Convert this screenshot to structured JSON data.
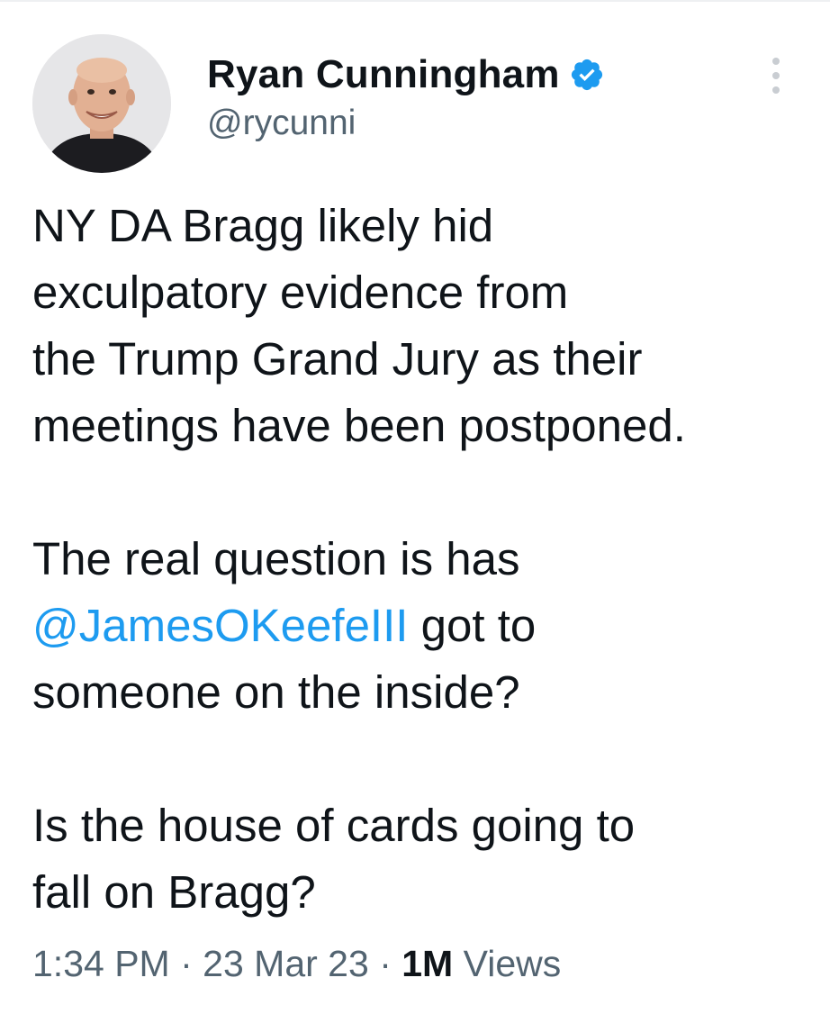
{
  "author": {
    "display_name": "Ryan Cunningham",
    "handle": "@rycunni",
    "verified": true,
    "avatar_icon": "profile-photo"
  },
  "tweet": {
    "paragraphs": [
      {
        "lines": [
          "NY DA Bragg likely hid",
          "exculpatory evidence from",
          "the Trump Grand Jury as their",
          "meetings have been postponed."
        ]
      },
      {
        "line1": "The real question is has",
        "mention": "@JamesOKeefeIII",
        "mention_suffix": " got to",
        "line3": "someone on the inside?"
      },
      {
        "lines": [
          "Is the house of cards going to",
          "fall on Bragg?"
        ]
      }
    ]
  },
  "meta": {
    "time": "1:34 PM",
    "separator": "·",
    "date": "23 Mar 23",
    "views_count": "1M",
    "views_label": "Views"
  },
  "colors": {
    "accent": "#1d9bf0",
    "text": "#0f1419",
    "secondary": "#536471"
  },
  "icons": {
    "verified": "verified-badge-icon",
    "more": "more-options-icon"
  }
}
